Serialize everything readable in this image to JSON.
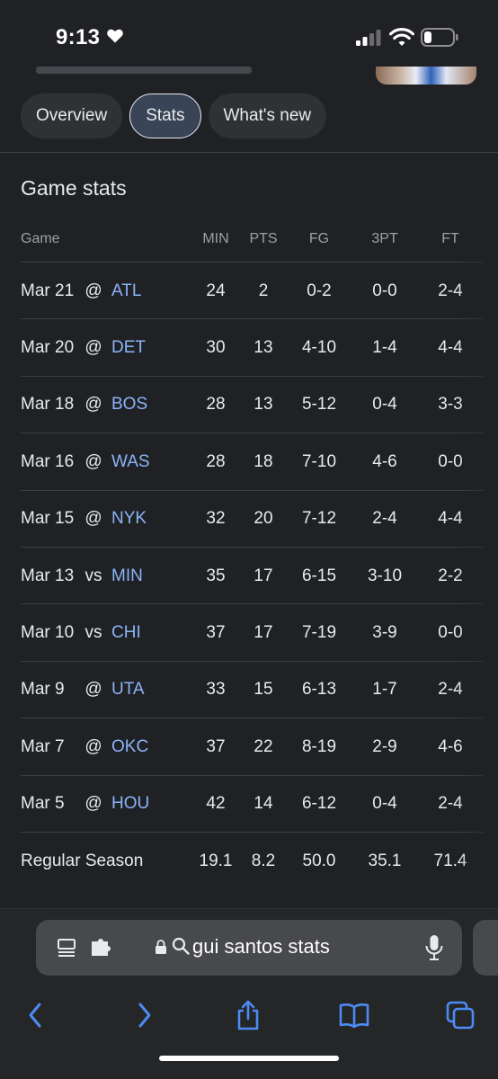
{
  "status": {
    "time": "9:13"
  },
  "tabs": [
    {
      "label": "Overview"
    },
    {
      "label": "Stats"
    },
    {
      "label": "What's new"
    }
  ],
  "section": {
    "title": "Game stats"
  },
  "table": {
    "headers": {
      "game": "Game",
      "min": "MIN",
      "pts": "PTS",
      "fg": "FG",
      "tpt": "3PT",
      "ft": "FT"
    },
    "rows": [
      {
        "date": "Mar 21",
        "loc": "@",
        "opp": "ATL",
        "min": "24",
        "pts": "2",
        "fg": "0-2",
        "tpt": "0-0",
        "ft": "2-4"
      },
      {
        "date": "Mar 20",
        "loc": "@",
        "opp": "DET",
        "min": "30",
        "pts": "13",
        "fg": "4-10",
        "tpt": "1-4",
        "ft": "4-4"
      },
      {
        "date": "Mar 18",
        "loc": "@",
        "opp": "BOS",
        "min": "28",
        "pts": "13",
        "fg": "5-12",
        "tpt": "0-4",
        "ft": "3-3"
      },
      {
        "date": "Mar 16",
        "loc": "@",
        "opp": "WAS",
        "min": "28",
        "pts": "18",
        "fg": "7-10",
        "tpt": "4-6",
        "ft": "0-0"
      },
      {
        "date": "Mar 15",
        "loc": "@",
        "opp": "NYK",
        "min": "32",
        "pts": "20",
        "fg": "7-12",
        "tpt": "2-4",
        "ft": "4-4"
      },
      {
        "date": "Mar 13",
        "loc": "vs",
        "opp": "MIN",
        "min": "35",
        "pts": "17",
        "fg": "6-15",
        "tpt": "3-10",
        "ft": "2-2"
      },
      {
        "date": "Mar 10",
        "loc": "vs",
        "opp": "CHI",
        "min": "37",
        "pts": "17",
        "fg": "7-19",
        "tpt": "3-9",
        "ft": "0-0"
      },
      {
        "date": "Mar 9",
        "loc": "@",
        "opp": "UTA",
        "min": "33",
        "pts": "15",
        "fg": "6-13",
        "tpt": "1-7",
        "ft": "2-4"
      },
      {
        "date": "Mar 7",
        "loc": "@",
        "opp": "OKC",
        "min": "37",
        "pts": "22",
        "fg": "8-19",
        "tpt": "2-9",
        "ft": "4-6"
      },
      {
        "date": "Mar 5",
        "loc": "@",
        "opp": "HOU",
        "min": "42",
        "pts": "14",
        "fg": "6-12",
        "tpt": "0-4",
        "ft": "2-4"
      }
    ],
    "season": {
      "label": "Regular Season",
      "min": "19.1",
      "pts": "8.2",
      "fg": "50.0",
      "tpt": "35.1",
      "ft": "71.4"
    }
  },
  "browser": {
    "address": "gui santos stats",
    "icons": [
      "reader-icon",
      "extension-icon",
      "lock-icon",
      "search-icon",
      "microphone-icon",
      "back-icon",
      "forward-icon",
      "share-icon",
      "bookmarks-icon",
      "tabs-icon"
    ]
  },
  "colors": {
    "background": "#202124",
    "link": "#8ab4f8",
    "browser_accent": "#4c8bf5"
  }
}
